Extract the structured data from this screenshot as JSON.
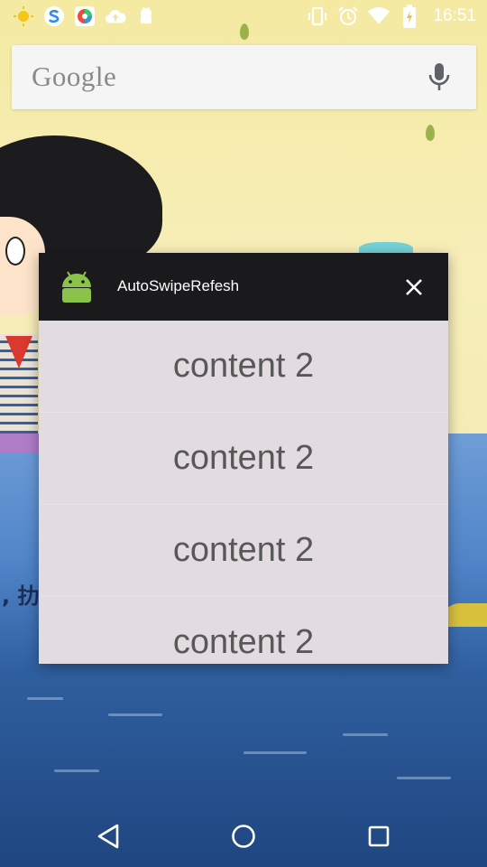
{
  "status_bar": {
    "time": "16:51",
    "left_icons": [
      "sun-notification-icon",
      "s-app-icon",
      "browser-app-icon",
      "cloud-upload-icon",
      "android-debug-icon"
    ],
    "right_icons": [
      "vibrate-icon",
      "alarm-icon",
      "wifi-icon",
      "battery-icon"
    ]
  },
  "search_widget": {
    "logo_text": "Google",
    "mic_icon": "microphone-icon"
  },
  "dialog": {
    "title": "AutoSwipeRefesh",
    "app_icon": "android-icon",
    "close_icon": "close-icon",
    "items": [
      {
        "label": "content 2"
      },
      {
        "label": "content 2"
      },
      {
        "label": "content 2"
      },
      {
        "label": "content 2"
      }
    ]
  },
  "nav_bar": {
    "back_icon": "back-triangle-icon",
    "home_icon": "home-circle-icon",
    "recents_icon": "recents-square-icon"
  },
  "colors": {
    "dialog_header": "#1a1a1c",
    "dialog_body": "#e2dbe0",
    "item_text": "#585858",
    "wallpaper_sky": "#f4eaa2",
    "wallpaper_sea": "#4f84c8"
  }
}
